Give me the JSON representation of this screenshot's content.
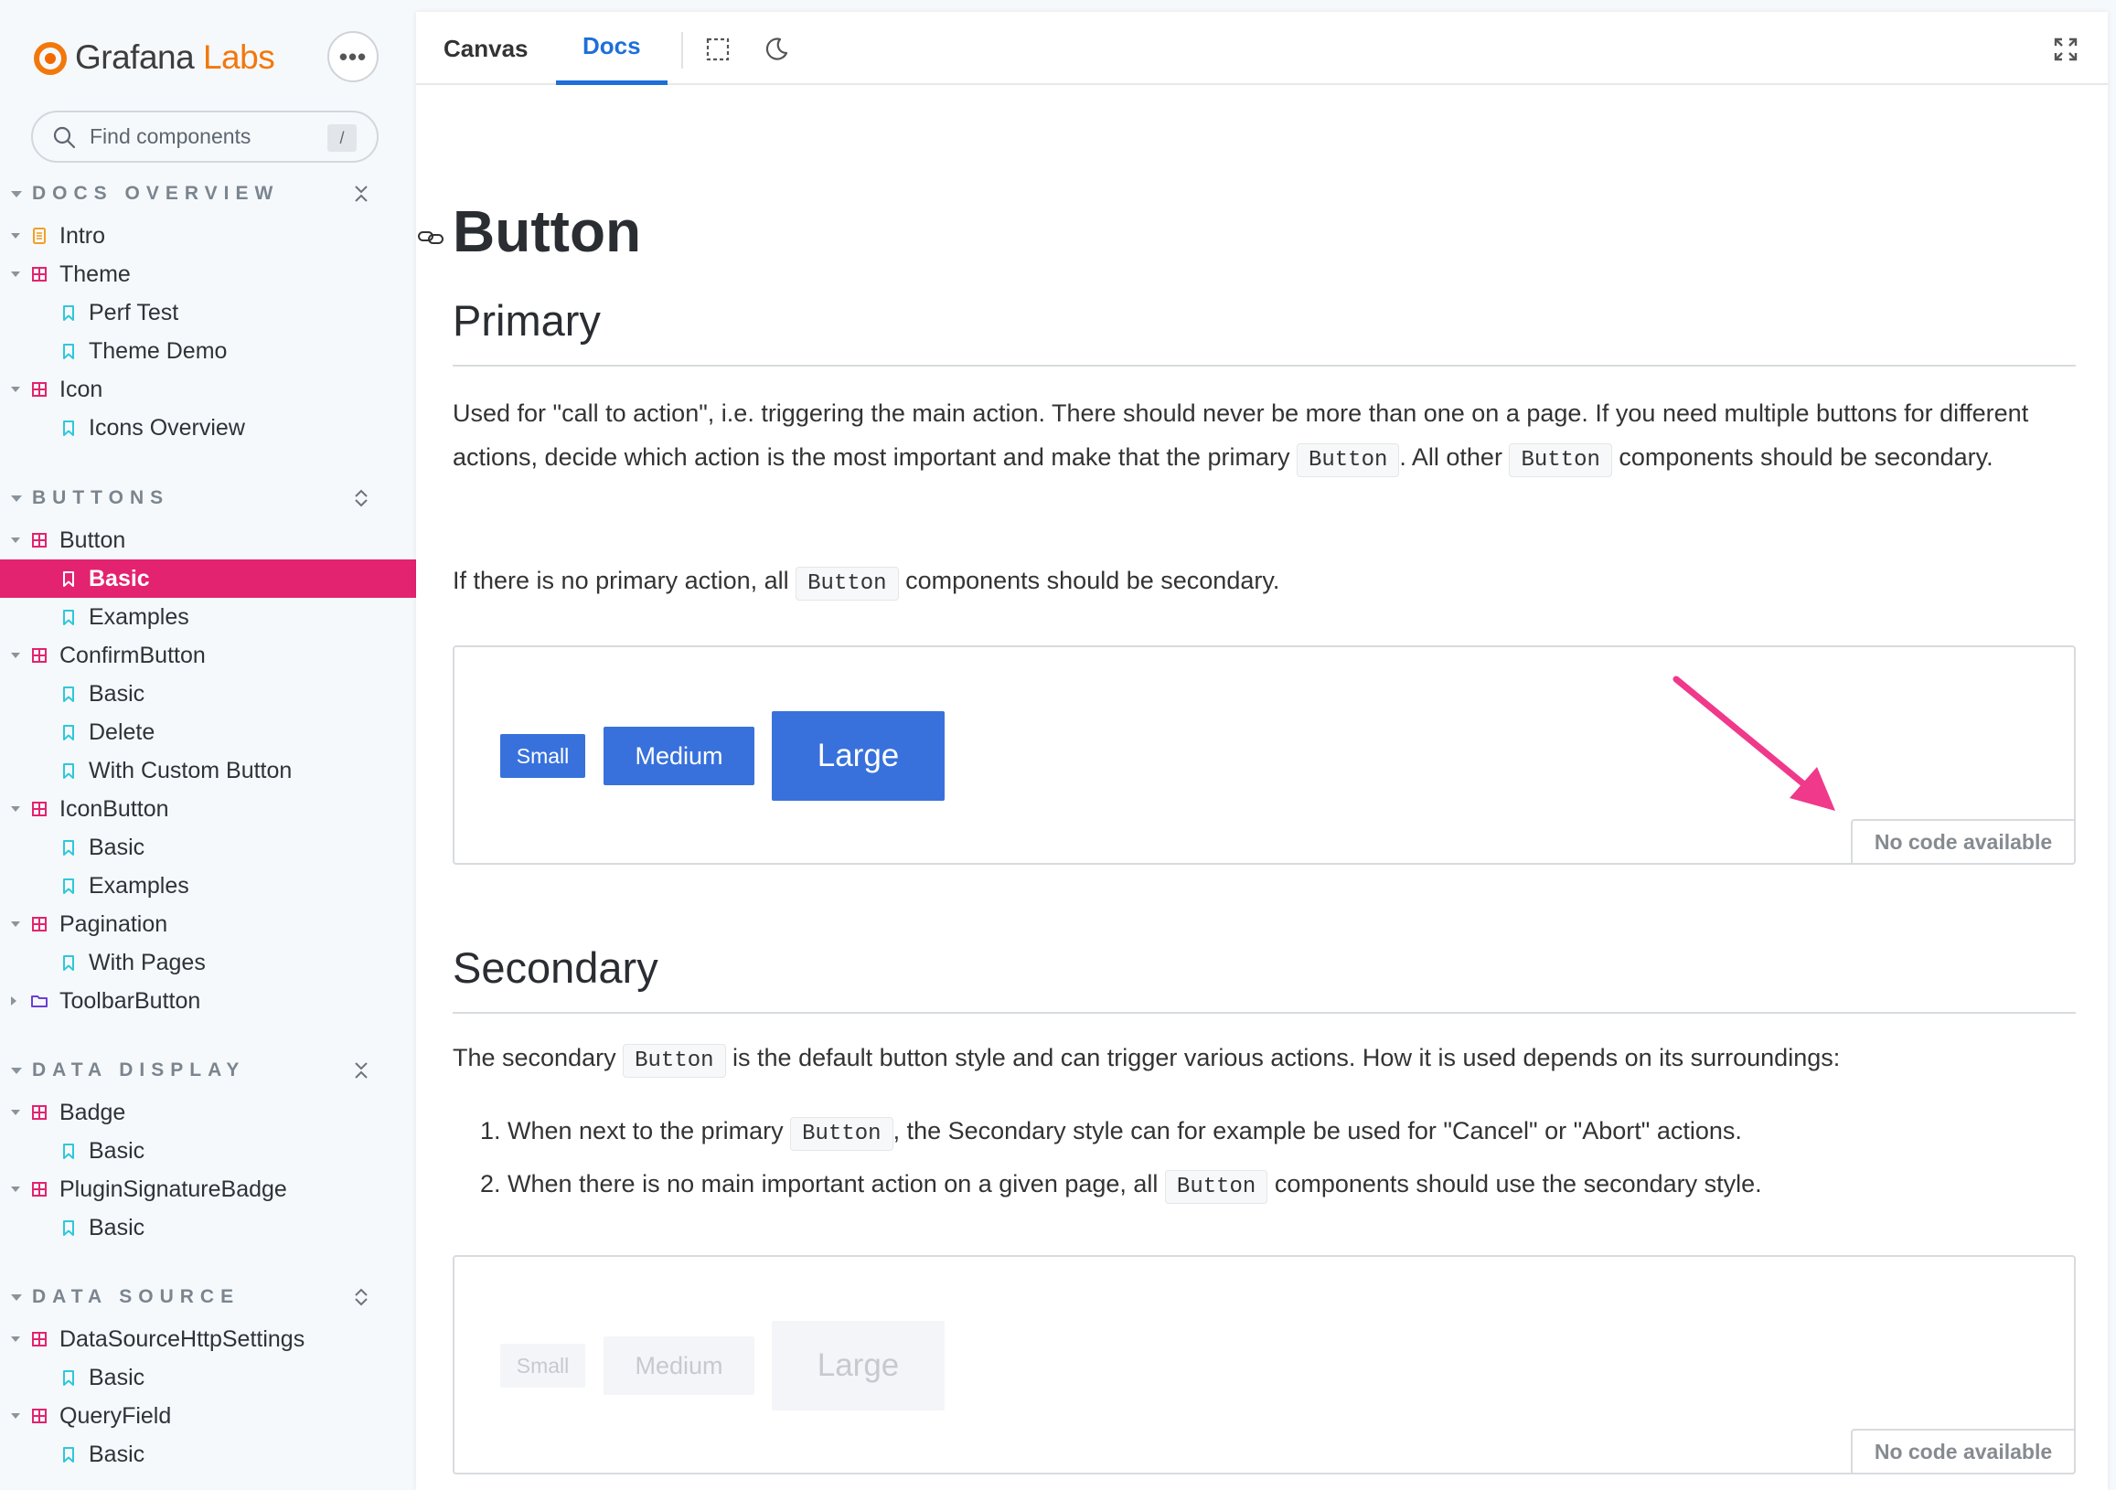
{
  "brand": {
    "name_part1": "Grafana",
    "name_part2": " Labs",
    "more_label": "•••"
  },
  "search": {
    "placeholder": "Find components",
    "shortcut": "/"
  },
  "sidebar": {
    "sections": [
      {
        "title": "DOCS OVERVIEW",
        "items": [
          {
            "label": "Intro",
            "icon": "document-icon"
          },
          {
            "label": "Theme",
            "icon": "component-icon"
          },
          {
            "label": "Perf Test",
            "icon": "bookmark-icon"
          },
          {
            "label": "Theme Demo",
            "icon": "bookmark-icon"
          },
          {
            "label": "Icon",
            "icon": "component-icon"
          },
          {
            "label": "Icons Overview",
            "icon": "bookmark-icon"
          }
        ]
      },
      {
        "title": "BUTTONS",
        "items": [
          {
            "label": "Button",
            "icon": "component-icon"
          },
          {
            "label": "Basic",
            "icon": "bookmark-icon",
            "selected": true
          },
          {
            "label": "Examples",
            "icon": "bookmark-icon"
          },
          {
            "label": "ConfirmButton",
            "icon": "component-icon"
          },
          {
            "label": "Basic",
            "icon": "bookmark-icon"
          },
          {
            "label": "Delete",
            "icon": "bookmark-icon"
          },
          {
            "label": "With Custom Button",
            "icon": "bookmark-icon"
          },
          {
            "label": "IconButton",
            "icon": "component-icon"
          },
          {
            "label": "Basic",
            "icon": "bookmark-icon"
          },
          {
            "label": "Examples",
            "icon": "bookmark-icon"
          },
          {
            "label": "Pagination",
            "icon": "component-icon"
          },
          {
            "label": "With Pages",
            "icon": "bookmark-icon"
          },
          {
            "label": "ToolbarButton",
            "icon": "folder-icon"
          }
        ]
      },
      {
        "title": "DATA DISPLAY",
        "items": [
          {
            "label": "Badge",
            "icon": "component-icon"
          },
          {
            "label": "Basic",
            "icon": "bookmark-icon"
          },
          {
            "label": "PluginSignatureBadge",
            "icon": "component-icon"
          },
          {
            "label": "Basic",
            "icon": "bookmark-icon"
          }
        ]
      },
      {
        "title": "DATA SOURCE",
        "items": [
          {
            "label": "DataSourceHttpSettings",
            "icon": "component-icon"
          },
          {
            "label": "Basic",
            "icon": "bookmark-icon"
          },
          {
            "label": "QueryField",
            "icon": "component-icon"
          },
          {
            "label": "Basic",
            "icon": "bookmark-icon"
          }
        ]
      }
    ]
  },
  "toolbar": {
    "tabs": [
      "Canvas",
      "Docs"
    ],
    "active_tab": "Docs",
    "icons": [
      "outline-icon",
      "moon-icon",
      "fullscreen-icon"
    ]
  },
  "doc": {
    "title": "Button",
    "primary": {
      "heading": "Primary",
      "p1_a": "Used for \"call to action\", i.e. triggering the main action. There should never be more than one on a page. If you need multiple buttons for different actions, decide which action is the most important and make that the primary ",
      "p1_code1": "Button",
      "p1_b": ". All other ",
      "p1_code2": "Button",
      "p1_c": " components should be secondary.",
      "p2_a": "If there is no primary action, all ",
      "p2_code": "Button",
      "p2_b": " components should be secondary.",
      "buttons": [
        "Small",
        "Medium",
        "Large"
      ],
      "no_code": "No code available"
    },
    "secondary": {
      "heading": "Secondary",
      "p1_a": "The secondary ",
      "p1_code": "Button",
      "p1_b": " is the default button style and can trigger various actions. How it is used depends on its surroundings:",
      "li1_a": "When next to the primary ",
      "li1_code": "Button",
      "li1_b": ", the Secondary style can for example be used for \"Cancel\" or \"Abort\" actions.",
      "li2_a": "When there is no main important action on a given page, all ",
      "li2_code": "Button",
      "li2_b": " components should use the secondary style.",
      "buttons": [
        "Small",
        "Medium",
        "Large"
      ],
      "no_code": "No code available"
    }
  },
  "colors": {
    "accent": "#e3236f",
    "primary_button": "#3871dc",
    "tab_active": "#1e6fd9",
    "brand_orange": "#f2780c",
    "annotation_arrow": "#f0398a"
  }
}
